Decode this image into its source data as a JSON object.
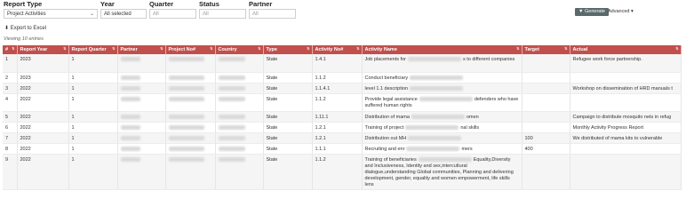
{
  "filters": {
    "report_type": {
      "label": "Report Type",
      "value": "Project Activities"
    },
    "year": {
      "label": "Year",
      "value": "All selected"
    },
    "quarter": {
      "label": "Quarter",
      "placeholder": "All"
    },
    "status": {
      "label": "Status",
      "placeholder": "All"
    },
    "partner": {
      "label": "Partner",
      "placeholder": "All"
    }
  },
  "toolbar": {
    "generate_label": "Generate",
    "advanced_label": "Advanced"
  },
  "export_label": "Export to Excel",
  "viewing_text": "Viewing 10 entries",
  "table": {
    "headers": [
      "#",
      "Report Year",
      "Report Quarter",
      "Partner",
      "Project No#",
      "Country",
      "Type",
      "Activity No#",
      "Activity Name",
      "Target",
      "Actual"
    ],
    "rows": [
      {
        "n": "1",
        "year": "2023",
        "quarter": "1",
        "type": "State",
        "act_no": "1.4.1",
        "act_name_a": "Job placements for",
        "act_name_b": "s to different companies",
        "target": "",
        "actual": "Refugee work force partnership."
      },
      {
        "n": "2",
        "year": "2023",
        "quarter": "1",
        "type": "State",
        "act_no": "1.1.2",
        "act_name_a": "Conduct beneficiary",
        "act_name_b": "",
        "target": "",
        "actual": ""
      },
      {
        "n": "3",
        "year": "2022",
        "quarter": "1",
        "type": "State",
        "act_no": "1.1.4.1",
        "act_name_a": "level 1.1 description",
        "act_name_b": "",
        "target": "",
        "actual": "Workshop on dissemination of HRD manuals t"
      },
      {
        "n": "4",
        "year": "2022",
        "quarter": "1",
        "type": "State",
        "act_no": "1.1.2",
        "act_name_a": "Provide legal assistance",
        "act_name_b": "defenders who have suffered human rights",
        "target": "",
        "actual": ""
      },
      {
        "n": "5",
        "year": "2022",
        "quarter": "1",
        "type": "State",
        "act_no": "1.11.1",
        "act_name_a": "Distribution of mama",
        "act_name_b": "omen",
        "target": "",
        "actual": "Campaign to distribute mosquito nets in refug"
      },
      {
        "n": "6",
        "year": "2022",
        "quarter": "1",
        "type": "State",
        "act_no": "1.2.1",
        "act_name_a": "Training of project",
        "act_name_b": "nal skills",
        "target": "",
        "actual": "Monthly Activity Progress Report"
      },
      {
        "n": "7",
        "year": "2022",
        "quarter": "1",
        "type": "State",
        "act_no": "1.2.1",
        "act_name_a": "Distribution out MH",
        "act_name_b": "",
        "target": "100",
        "actual": "We distributed of mama kits to vulnerable"
      },
      {
        "n": "8",
        "year": "2022",
        "quarter": "1",
        "type": "State",
        "act_no": "1.1.1",
        "act_name_a": "Recruiting and enr",
        "act_name_b": "mers",
        "target": "400",
        "actual": ""
      },
      {
        "n": "9",
        "year": "2022",
        "quarter": "1",
        "type": "State",
        "act_no": "1.1.2",
        "act_name_a": "Training of beneficiaries",
        "act_name_b": "Equality,Diversity and Inclusiveness, Identity and sex,intercultural dialogue,understanding Global communities, Planning and delivering development, gender, equality and women empowerment, life skills lens",
        "target": "",
        "actual": ""
      }
    ]
  }
}
